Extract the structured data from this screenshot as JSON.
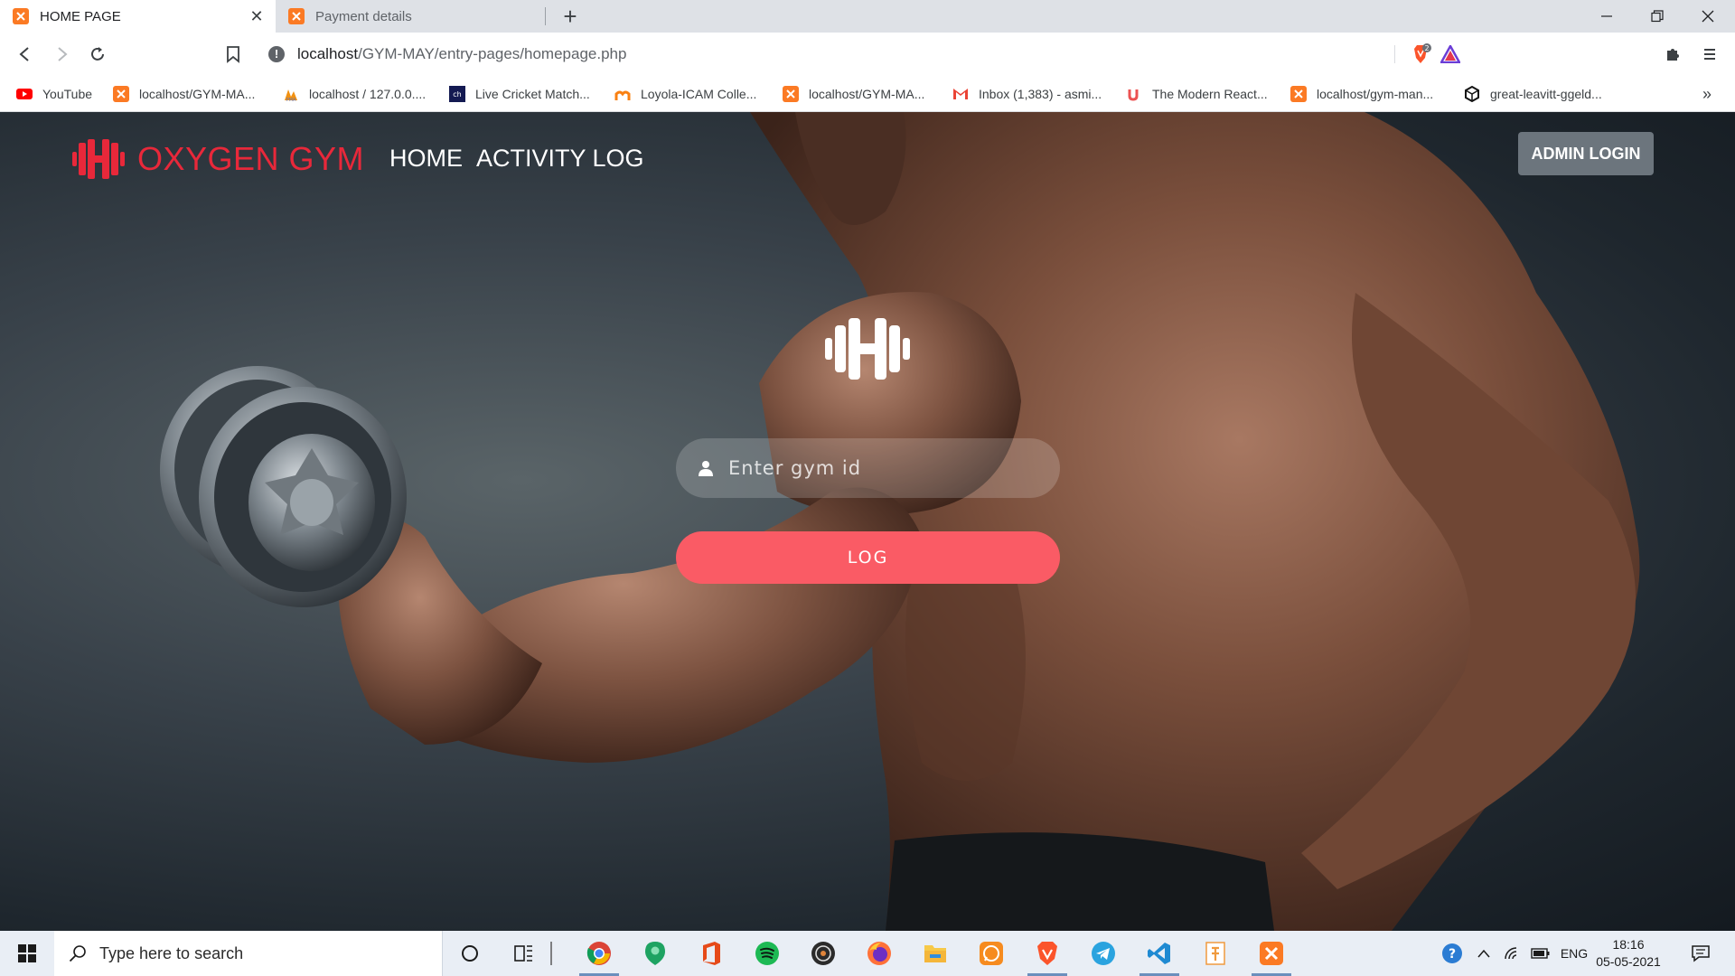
{
  "browser": {
    "tabs": [
      {
        "title": "HOME PAGE",
        "favicon": "xampp-icon",
        "active": true
      },
      {
        "title": "Payment details",
        "favicon": "xampp-icon",
        "active": false
      }
    ],
    "address": {
      "host": "localhost",
      "path": "/GYM-MAY/entry-pages/homepage.php"
    },
    "brave_shields_count": "2",
    "bookmarks": [
      {
        "label": "YouTube",
        "icon": "youtube-icon"
      },
      {
        "label": "localhost/GYM-MA...",
        "icon": "xampp-icon"
      },
      {
        "label": "localhost / 127.0.0....",
        "icon": "phpmyadmin-icon"
      },
      {
        "label": "Live Cricket Match...",
        "icon": "cricket-icon"
      },
      {
        "label": "Loyola-ICAM Colle...",
        "icon": "moodle-icon"
      },
      {
        "label": "localhost/GYM-MA...",
        "icon": "xampp-icon"
      },
      {
        "label": "Inbox (1,383) - asmi...",
        "icon": "gmail-icon"
      },
      {
        "label": "The Modern React...",
        "icon": "udemy-icon"
      },
      {
        "label": "localhost/gym-man...",
        "icon": "xampp-icon"
      },
      {
        "label": "great-leavitt-ggeld...",
        "icon": "codesandbox-icon"
      }
    ]
  },
  "site": {
    "brand": "OXYGEN GYM",
    "nav": [
      "HOME",
      "ACTIVITY LOG"
    ],
    "admin_button": "ADMIN LOGIN",
    "input_placeholder": "Enter gym id",
    "log_button": "LOG",
    "colors": {
      "brand": "#e8283a",
      "log_button": "#fa5b65",
      "admin_button": "#6c757d"
    }
  },
  "taskbar": {
    "search_placeholder": "Type here to search",
    "language": "ENG",
    "time": "18:16",
    "date": "05-05-2021"
  }
}
